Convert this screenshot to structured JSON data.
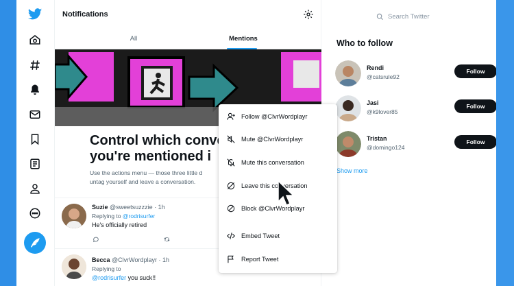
{
  "header": {
    "title": "Notifications"
  },
  "tabs": [
    {
      "label": "All"
    },
    {
      "label": "Mentions"
    }
  ],
  "hero": {
    "headline_line1": "Control which conve",
    "headline_line2": "you're mentioned i",
    "subtext_line1": "Use the actions menu — those three little d",
    "subtext_line2": "untag yourself and leave a conversation."
  },
  "tweets": [
    {
      "name": "Suzie",
      "handle": "@sweetsuzzzie · 1h",
      "replying_prefix": "Replying to ",
      "replying_to": "@rodrisurfer",
      "body": "He's officially retired",
      "body_mention": "",
      "body_rest": ""
    },
    {
      "name": "Becca",
      "handle": "@ClvrWordplayr · 1h",
      "replying_prefix": "Replying to",
      "replying_to": "",
      "body": "",
      "body_mention": "@rodrisurfer",
      "body_rest": " you suck!!"
    }
  ],
  "menu": {
    "items": [
      {
        "label": "Follow @ClvrWordplayr",
        "icon": "follow-user-icon"
      },
      {
        "label": "Mute @ClvrWordplayr",
        "icon": "mute-icon"
      },
      {
        "label": "Mute this conversation",
        "icon": "mute-conversation-icon"
      },
      {
        "label": "Leave this conversation",
        "icon": "leave-conversation-icon"
      },
      {
        "label": "Block @ClvrWordplayr",
        "icon": "block-icon"
      },
      {
        "label": "Embed Tweet",
        "icon": "embed-icon"
      },
      {
        "label": "Report Tweet",
        "icon": "report-flag-icon"
      }
    ]
  },
  "search": {
    "placeholder": "Search Twitter"
  },
  "who_to_follow": {
    "title": "Who to follow",
    "accounts": [
      {
        "name": "Rendi",
        "handle": "@catsrule92",
        "button": "Follow"
      },
      {
        "name": "Jasi",
        "handle": "@k9lover85",
        "button": "Follow"
      },
      {
        "name": "Tristan",
        "handle": "@domingo124",
        "button": "Follow"
      }
    ],
    "show_more": "Show more"
  },
  "colors": {
    "accent": "#1d9bf0",
    "background_frame": "#2f8ee6",
    "follow_button": "#0f1419",
    "hero_magenta": "#e340d8",
    "hero_teal": "#2f8a8c"
  }
}
